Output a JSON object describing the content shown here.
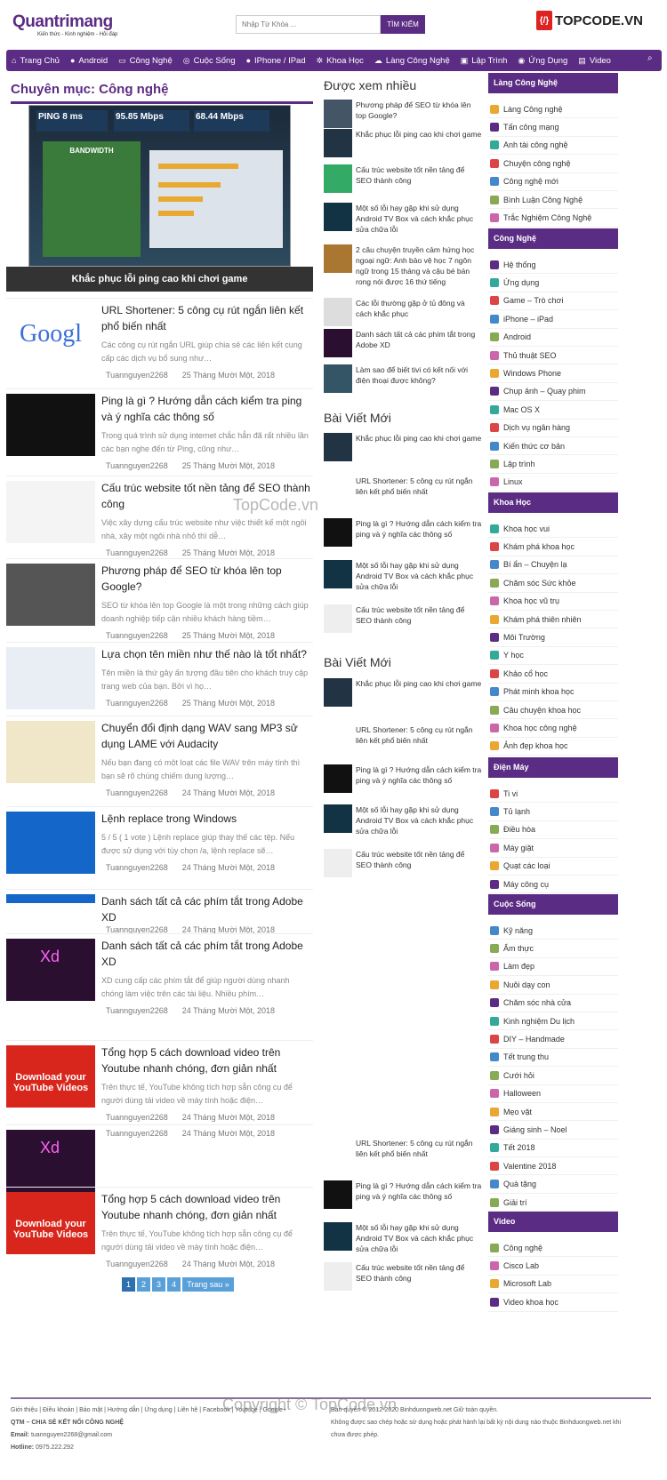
{
  "header": {
    "logo_text": "Quantrimang",
    "logo_tagline": "Kiến thức - Kinh nghiệm - Hỏi đáp",
    "search_placeholder": "Nhập Từ Khóa ...",
    "search_button": "TÌM KIẾM",
    "brand": "TOPCODE.VN"
  },
  "nav": [
    {
      "icon": "home-icon",
      "g": "⌂",
      "label": "Trang Chủ"
    },
    {
      "icon": "android-icon",
      "g": "●",
      "label": "Android"
    },
    {
      "icon": "laptop-icon",
      "g": "▭",
      "label": "Công Nghệ"
    },
    {
      "icon": "life-icon",
      "g": "◎",
      "label": "Cuộc Sống"
    },
    {
      "icon": "apple-icon",
      "g": "●",
      "label": "IPhone / IPad"
    },
    {
      "icon": "atom-icon",
      "g": "✲",
      "label": "Khoa Học"
    },
    {
      "icon": "chat-icon",
      "g": "☁",
      "label": "Làng Công Nghệ"
    },
    {
      "icon": "code-icon",
      "g": "▣",
      "label": "Lập Trình"
    },
    {
      "icon": "app-icon",
      "g": "◉",
      "label": "Ứng Dụng"
    },
    {
      "icon": "film-icon",
      "g": "▤",
      "label": "Video"
    }
  ],
  "main": {
    "title": "Chuyên mục: Công nghệ",
    "featured": {
      "caption": "Khắc phục lỗi ping cao khi chơi game",
      "ping": "PING 8 ms",
      "download": "95.85 Mbps",
      "upload": "68.44 Mbps",
      "badge": "BANDWIDTH"
    },
    "articles": [
      {
        "title": "URL Shortener: 5 công cụ rút ngắn liên kết phổ biến nhất",
        "excerpt": "Các công cụ rút ngắn URL giúp chia sẻ các liên kết cung cấp các dịch vụ bổ sung như…",
        "author": "Tuannguyen2268",
        "date": "25 Tháng Mười Một, 2018",
        "thumb": "google"
      },
      {
        "title": "Ping là gì ? Hướng dẫn cách kiểm tra ping và ý nghĩa các thông số",
        "excerpt": "Trong quá trình sử dụng internet chắc hẳn đã rất nhiều lần các bạn nghe đến từ Ping, cũng như…",
        "author": "Tuannguyen2268",
        "date": "25 Tháng Mười Một, 2018",
        "thumb": "cmd"
      },
      {
        "title": "Cấu trúc website tốt nền tảng để SEO thành công",
        "excerpt": "Việc xây dựng cấu trúc website như việc thiết kế một ngôi nhà, xây một ngôi nhà nhỏ thì dễ…",
        "author": "Tuannguyen2268",
        "date": "25 Tháng Mười Một, 2018",
        "thumb": "doc"
      },
      {
        "title": "Phương pháp để SEO từ khóa lên top Google?",
        "excerpt": "SEO từ khóa lên top Google là một trong những cách giúp doanh nghiệp tiếp cận nhiều khách hàng tiềm…",
        "author": "Tuannguyen2268",
        "date": "25 Tháng Mười Một, 2018",
        "thumb": "laptop"
      },
      {
        "title": "Lựa chọn tên miền như thế nào là tốt nhất?",
        "excerpt": "Tên miền là thứ gây ấn tượng đầu tiên cho khách truy cập trang web của bạn. Bởi vì họ…",
        "author": "Tuannguyen2268",
        "date": "25 Tháng Mười Một, 2018",
        "thumb": "domain"
      },
      {
        "title": "Chuyển đổi định dạng WAV sang MP3 sử dụng LAME với Audacity",
        "excerpt": "Nếu bạn đang có một loạt các file WAV trên máy tính thì bạn sẽ rõ chúng chiếm dung lượng…",
        "author": "Tuannguyen2268",
        "date": "24 Tháng Mười Một, 2018",
        "thumb": "audacity"
      },
      {
        "title": "Lệnh replace trong Windows",
        "excerpt": "5 / 5 ( 1 vote ) Lệnh replace giúp thay thế các tệp. Nếu được sử dụng với tùy chọn /a, lệnh replace sẽ…",
        "author": "Tuannguyen2268",
        "date": "24 Tháng Mười Một, 2018",
        "thumb": "windows"
      },
      {
        "title": "Danh sách tất cả các phím tắt trong Adobe XD",
        "excerpt": "",
        "author": "Tuannguyen2268",
        "date": "24 Tháng Mười Một, 2018",
        "thumb": "windows"
      },
      {
        "title": "Danh sách tất cả các phím tắt trong Adobe XD",
        "excerpt": "XD cung cấp các phím tắt để giúp người dùng nhanh chóng làm việc trên các tài liệu. Nhiều phím…",
        "author": "Tuannguyen2268",
        "date": "24 Tháng Mười Một, 2018",
        "thumb": "xd"
      },
      {
        "title": "Tổng hợp 5 cách download video trên Youtube nhanh chóng, đơn giản nhất",
        "excerpt": "Trên thực tế, YouTube không tích hợp sẵn công cụ để người dùng tải video về máy tính hoặc điện…",
        "author": "Tuannguyen2268",
        "date": "24 Tháng Mười Một, 2018",
        "thumb": "yt"
      },
      {
        "title": "",
        "excerpt": "",
        "author": "Tuannguyen2268",
        "date": "24 Tháng Mười Một, 2018",
        "thumb": "xd"
      },
      {
        "title": "Tổng hợp 5 cách download video trên Youtube nhanh chóng, đơn giản nhất",
        "excerpt": "Trên thực tế, YouTube không tích hợp sẵn công cụ để người dùng tải video về máy tính hoặc điện…",
        "author": "Tuannguyen2268",
        "date": "24 Tháng Mười Một, 2018",
        "thumb": "yt"
      }
    ],
    "thumb_text": {
      "google": "Googl",
      "yt": "Download your YouTube Videos",
      "xd": "Xd"
    },
    "pagination": [
      "1",
      "2",
      "3",
      "4",
      "Trang sau »"
    ]
  },
  "middle": {
    "popular_title": "Được xem nhiều",
    "popular": [
      "Phương pháp để SEO từ khóa lên top Google?",
      "Khắc phục lỗi ping cao khi chơi game",
      "Cấu trúc website tốt nền tảng để SEO thành công",
      "Một số lỗi hay gặp khi sử dụng Android TV Box và cách khắc phục sửa chữa lỗi",
      "2 câu chuyện truyền cảm hứng học ngoại ngữ: Anh bảo vệ học 7 ngôn ngữ trong 15 tháng và cậu bé bán rong nói được 16 thứ tiếng",
      "Các lỗi thường gặp ở tủ đông và cách khắc phục",
      "Danh sách tất cả các phím tắt trong Adobe XD",
      "Làm sao để biết tivi có kết nối với điện thoại được không?"
    ],
    "recent_title": "Bài Viết Mới",
    "recent": [
      "Khắc phục lỗi ping cao khi chơi game",
      "URL Shortener: 5 công cụ rút ngắn liên kết phổ biến nhất",
      "Ping là gì ? Hướng dẫn cách kiểm tra ping và ý nghĩa các thông số",
      "Một số lỗi hay gặp khi sử dụng Android TV Box và cách khắc phục sửa chữa lỗi",
      "Cấu trúc website tốt nền tảng để SEO thành công"
    ],
    "recent2_title": "Bài Viết Mới",
    "recent2": [
      "Khắc phục lỗi ping cao khi chơi game",
      "URL Shortener: 5 công cụ rút ngắn liên kết phổ biến nhất",
      "Ping là gì ? Hướng dẫn cách kiểm tra ping và ý nghĩa các thông số",
      "Một số lỗi hay gặp khi sử dụng Android TV Box và cách khắc phục sửa chữa lỗi",
      "Cấu trúc website tốt nền tảng để SEO thành công"
    ],
    "recent3": [
      "URL Shortener: 5 công cụ rút ngắn liên kết phổ biến nhất",
      "Ping là gì ? Hướng dẫn cách kiểm tra ping và ý nghĩa các thông số",
      "Một số lỗi hay gặp khi sử dụng Android TV Box và cách khắc phục sửa chữa lỗi",
      "Cấu trúc website tốt nền tảng để SEO thành công"
    ]
  },
  "sidebar": [
    {
      "title": "Làng Công Nghệ",
      "items": [
        "Làng Công nghệ",
        "Tấn công mạng",
        "Anh tài công nghệ",
        "Chuyện công nghệ",
        "Công nghệ mới",
        "Bình Luận Công Nghệ",
        "Trắc Nghiệm Công Nghệ"
      ]
    },
    {
      "title": "Công Nghệ",
      "items": [
        "Hệ thống",
        "Ứng dụng",
        "Game – Trò chơi",
        "iPhone – iPad",
        "Android",
        "Thủ thuật SEO",
        "Windows Phone",
        "Chụp ảnh – Quay phim",
        "Mac OS X",
        "Dịch vụ ngân hàng",
        "Kiến thức cơ bản",
        "Lập trình",
        "Linux"
      ]
    },
    {
      "title": "Khoa Học",
      "items": [
        "Khoa học vui",
        "Khám phá khoa học",
        "Bí ẩn – Chuyện lạ",
        "Chăm sóc Sức khỏe",
        "Khoa học vũ trụ",
        "Khám phá thiên nhiên",
        "Môi Trường",
        "Y học",
        "Khảo cổ học",
        "Phát minh khoa học",
        "Câu chuyện khoa học",
        "Khoa học công nghệ",
        "Ảnh đẹp khoa học"
      ]
    },
    {
      "title": "Điện Máy",
      "items": [
        "Ti vi",
        "Tủ lạnh",
        "Điều hòa",
        "Máy giặt",
        "Quạt các loại",
        "Máy công cụ"
      ]
    },
    {
      "title": "Cuộc Sống",
      "items": [
        "Kỹ năng",
        "Ẩm thực",
        "Làm đẹp",
        "Nuôi dạy con",
        "Chăm sóc nhà cửa",
        "Kinh nghiệm Du lịch",
        "DIY – Handmade",
        "Tết trung thu",
        "Cưới hỏi",
        "Halloween",
        "Mẹo vặt",
        "Giáng sinh – Noel",
        "Tết 2018",
        "Valentine 2018",
        "Quà tặng",
        "Giải trí"
      ]
    },
    {
      "title": "Video",
      "items": [
        "Công nghệ",
        "Cisco Lab",
        "Microsoft Lab",
        "Video khoa học"
      ]
    }
  ],
  "footer": {
    "links": "Giới thiệu | Điều khoản | Bảo mật | Hướng dẫn | Ứng dụng | Liên hệ | Facebook | Youtube | Google+",
    "org": "QTM – CHIA SẺ KẾT NỐI CÔNG NGHỆ",
    "email_label": "Email:",
    "email": "tuannguyen2268@gmail.com",
    "hotline_label": "Hotline:",
    "hotline": "0975.222.292",
    "copyright": "Bản quyền © 2012-2020 Binhduongweb.net Giữ toàn quyền.",
    "notice": "Không được sao chép hoặc sử dụng hoặc phát hành lại bất kỳ nội dung nào thuộc Binhduongweb.net khi chưa được phép."
  },
  "watermarks": [
    "TopCode.vn",
    "Copyright © TopCode.vn"
  ],
  "colors": {
    "primary": "#5b2c83",
    "pager": "#5aa0d8"
  }
}
